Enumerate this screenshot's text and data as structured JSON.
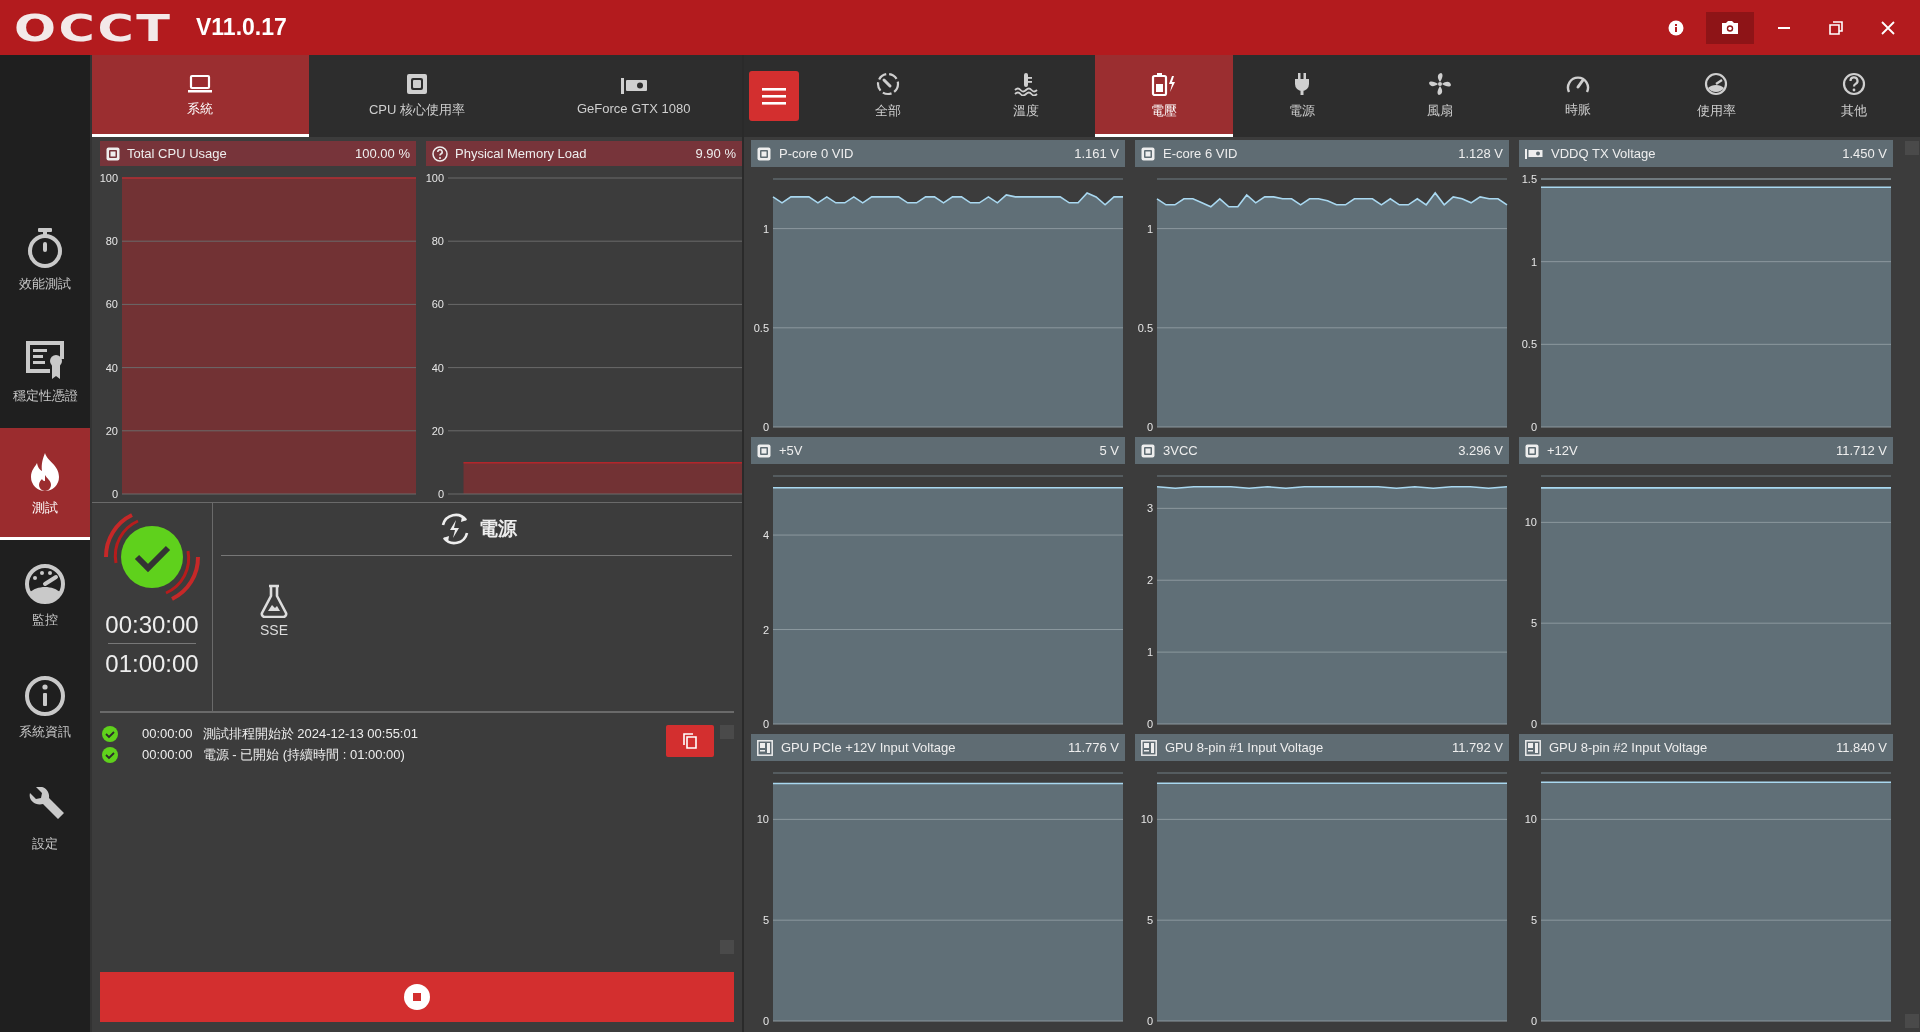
{
  "app": {
    "logo": "OCCT",
    "version": "V11.0.17"
  },
  "sidebar": {
    "items": [
      {
        "label": "效能測試",
        "selected": false
      },
      {
        "label": "穩定性憑證",
        "selected": false
      },
      {
        "label": "測試",
        "selected": true
      },
      {
        "label": "監控",
        "selected": false
      },
      {
        "label": "系統資訊",
        "selected": false
      },
      {
        "label": "設定",
        "selected": false
      }
    ]
  },
  "system_tabs": [
    {
      "label": "系統",
      "selected": true
    },
    {
      "label": "CPU 核心使用率",
      "selected": false
    },
    {
      "label": "GeForce GTX 1080",
      "selected": false
    }
  ],
  "usage_charts": [
    {
      "value": "100.00 %",
      "chart_data": {
        "type": "area",
        "grid": true,
        "series": [
          {
            "name": "Total CPU Usage",
            "color": "#b3262b",
            "values": [
              100,
              100,
              100,
              100,
              100,
              100,
              100,
              100,
              100,
              100,
              100,
              100,
              100,
              100,
              100,
              100,
              100,
              100,
              100,
              100
            ]
          }
        ],
        "ylim": [
          0,
          100
        ],
        "yticks": [
          0,
          20,
          40,
          60,
          80,
          100
        ]
      }
    },
    {
      "value": "9.90 %",
      "chart_data": {
        "type": "area",
        "grid": true,
        "series": [
          {
            "name": "Physical Memory Load",
            "color": "#b3262b",
            "values": [
              null,
              9.9,
              9.9,
              9.9,
              9.9,
              9.9,
              9.9,
              9.9,
              9.9,
              9.9,
              9.9,
              9.9,
              9.9,
              9.9,
              9.9,
              9.9,
              9.9,
              9.9,
              9.9,
              9.9
            ]
          }
        ],
        "ylim": [
          0,
          100
        ],
        "yticks": [
          0,
          20,
          40,
          60,
          80,
          100
        ]
      }
    }
  ],
  "test": {
    "passed": true,
    "elapsed": "00:30:00",
    "duration": "01:00:00",
    "title": "電源",
    "options": [
      {
        "label": "SSE"
      }
    ]
  },
  "log": [
    {
      "passed": true,
      "time": "00:00:00",
      "message": "測試排程開始於 2024-12-13 00:55:01"
    },
    {
      "passed": true,
      "time": "00:00:00",
      "message": "電源 - 已開始 (持續時間 : 01:00:00)"
    }
  ],
  "sensor_tabs": [
    {
      "label": "全部",
      "selected": false
    },
    {
      "label": "溫度",
      "selected": false
    },
    {
      "label": "電壓",
      "selected": true
    },
    {
      "label": "電源",
      "selected": false
    },
    {
      "label": "風扇",
      "selected": false
    },
    {
      "label": "時脈",
      "selected": false
    },
    {
      "label": "使用率",
      "selected": false
    },
    {
      "label": "其他",
      "selected": false
    }
  ],
  "sensors": [
    {
      "value": "1.161 V",
      "chart_data": {
        "type": "area",
        "grid": true,
        "series": [
          {
            "name": "P-core 0 VID",
            "color": "#a9d8f0",
            "values": [
              1.16,
              1.13,
              1.16,
              1.16,
              1.16,
              1.13,
              1.16,
              1.13,
              1.13,
              1.16,
              1.13,
              1.16,
              1.16,
              1.16,
              1.16,
              1.13,
              1.13,
              1.16,
              1.16,
              1.13,
              1.16,
              1.16,
              1.13,
              1.13,
              1.16,
              1.13,
              1.17,
              1.16,
              1.16,
              1.16,
              1.16,
              1.16,
              1.16,
              1.13,
              1.13,
              1.18,
              1.16,
              1.12,
              1.16,
              1.16
            ]
          }
        ],
        "ylim": [
          0,
          1.25
        ],
        "yticks": [
          0,
          0.5,
          1
        ]
      }
    },
    {
      "value": "1.128 V",
      "chart_data": {
        "type": "area",
        "grid": true,
        "series": [
          {
            "name": "E-core 6 VID",
            "color": "#a9d8f0",
            "values": [
              1.15,
              1.12,
              1.12,
              1.15,
              1.15,
              1.13,
              1.11,
              1.15,
              1.11,
              1.11,
              1.17,
              1.13,
              1.16,
              1.16,
              1.15,
              1.15,
              1.12,
              1.15,
              1.15,
              1.14,
              1.12,
              1.12,
              1.15,
              1.15,
              1.15,
              1.12,
              1.15,
              1.12,
              1.12,
              1.15,
              1.12,
              1.18,
              1.12,
              1.16,
              1.15,
              1.13,
              1.16,
              1.15,
              1.15,
              1.12
            ]
          }
        ],
        "ylim": [
          0,
          1.25
        ],
        "yticks": [
          0,
          0.5,
          1
        ]
      }
    },
    {
      "value": "1.450 V",
      "chart_data": {
        "type": "area",
        "grid": true,
        "series": [
          {
            "name": "VDDQ TX Voltage",
            "color": "#a9d8f0",
            "values": [
              1.45,
              1.45,
              1.45,
              1.45,
              1.45,
              1.45,
              1.45,
              1.45,
              1.45,
              1.45
            ]
          }
        ],
        "ylim": [
          0,
          1.5
        ],
        "yticks": [
          0,
          0.5,
          1,
          1.5
        ]
      }
    },
    {
      "value": "5 V",
      "chart_data": {
        "type": "area",
        "grid": true,
        "series": [
          {
            "name": "+5V",
            "color": "#a9d8f0",
            "values": [
              5,
              5,
              5,
              5,
              5,
              5,
              5,
              5,
              5,
              5
            ]
          }
        ],
        "ylim": [
          0,
          5.25
        ],
        "yticks": [
          0,
          2,
          4
        ]
      }
    },
    {
      "value": "3.296 V",
      "chart_data": {
        "type": "area",
        "grid": true,
        "series": [
          {
            "name": "3VCC",
            "color": "#a9d8f0",
            "values": [
              3.3,
              3.28,
              3.3,
              3.3,
              3.3,
              3.28,
              3.3,
              3.28,
              3.3,
              3.3,
              3.3,
              3.3,
              3.3,
              3.28,
              3.3,
              3.28,
              3.3,
              3.3,
              3.28,
              3.3
            ]
          }
        ],
        "ylim": [
          0,
          3.45
        ],
        "yticks": [
          0,
          1,
          2,
          3
        ]
      }
    },
    {
      "value": "11.712 V",
      "chart_data": {
        "type": "area",
        "grid": true,
        "series": [
          {
            "name": "+12V",
            "color": "#a9d8f0",
            "values": [
              11.71,
              11.71,
              11.71,
              11.71,
              11.71,
              11.71,
              11.71,
              11.71,
              11.71,
              11.71
            ]
          }
        ],
        "ylim": [
          0,
          12.3
        ],
        "yticks": [
          0,
          5,
          10
        ]
      }
    },
    {
      "value": "11.776 V",
      "chart_data": {
        "type": "area",
        "grid": true,
        "series": [
          {
            "name": "GPU PCIe +12V Input Voltage",
            "color": "#a9d8f0",
            "values": [
              11.78,
              11.78,
              11.78,
              11.78,
              11.78,
              11.78,
              11.78,
              11.78,
              11.78,
              11.78
            ]
          }
        ],
        "ylim": [
          0,
          12.3
        ],
        "yticks": [
          0,
          5,
          10
        ]
      }
    },
    {
      "value": "11.792 V",
      "chart_data": {
        "type": "area",
        "grid": true,
        "series": [
          {
            "name": "GPU 8-pin #1 Input Voltage",
            "color": "#a9d8f0",
            "values": [
              11.79,
              11.79,
              11.79,
              11.79,
              11.79,
              11.79,
              11.79,
              11.79,
              11.79,
              11.79
            ]
          }
        ],
        "ylim": [
          0,
          12.3
        ],
        "yticks": [
          0,
          5,
          10
        ]
      }
    },
    {
      "value": "11.840 V",
      "chart_data": {
        "type": "area",
        "grid": true,
        "series": [
          {
            "name": "GPU 8-pin #2 Input Voltage",
            "color": "#a9d8f0",
            "values": [
              11.84,
              11.84,
              11.84,
              11.84,
              11.84,
              11.84,
              11.84,
              11.84,
              11.84,
              11.84
            ]
          }
        ],
        "ylim": [
          0,
          12.3
        ],
        "yticks": [
          0,
          5,
          10
        ]
      }
    }
  ]
}
